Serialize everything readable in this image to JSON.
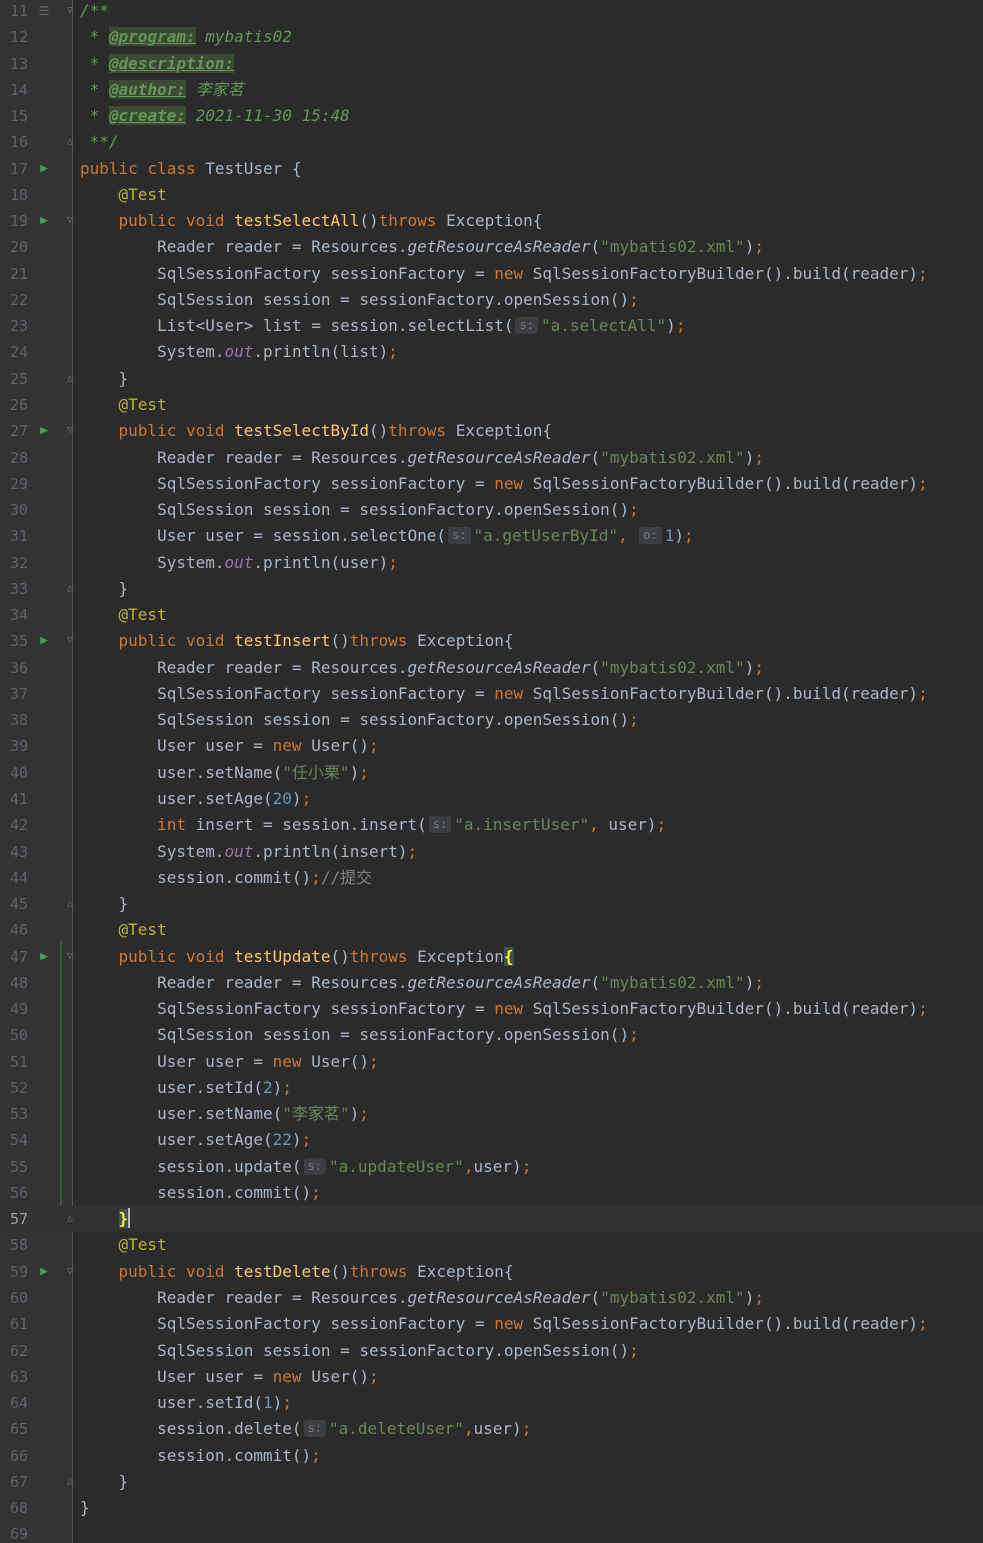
{
  "editor": {
    "current_line": "57",
    "lines": [
      {
        "n": "11",
        "icon": "structure",
        "fold": "open",
        "tokens": [
          {
            "t": "/**",
            "c": "dc"
          }
        ]
      },
      {
        "n": "12",
        "tokens": [
          {
            "t": " * ",
            "c": "dc"
          },
          {
            "t": "@program:",
            "c": "tg"
          },
          {
            "t": " mybatis02",
            "c": "dc"
          }
        ]
      },
      {
        "n": "13",
        "tokens": [
          {
            "t": " * ",
            "c": "dc"
          },
          {
            "t": "@description:",
            "c": "tg"
          }
        ]
      },
      {
        "n": "14",
        "tokens": [
          {
            "t": " * ",
            "c": "dc"
          },
          {
            "t": "@author:",
            "c": "tg"
          },
          {
            "t": " 李家茗",
            "c": "dc"
          }
        ]
      },
      {
        "n": "15",
        "tokens": [
          {
            "t": " * ",
            "c": "dc"
          },
          {
            "t": "@create:",
            "c": "tg"
          },
          {
            "t": " 2021-11-30 15:48",
            "c": "dc"
          }
        ]
      },
      {
        "n": "16",
        "fold": "close",
        "tokens": [
          {
            "t": " **/",
            "c": "dc"
          }
        ]
      },
      {
        "n": "17",
        "icon": "run",
        "tokens": [
          {
            "t": "public class ",
            "c": "kw"
          },
          {
            "t": "TestUser {"
          }
        ]
      },
      {
        "n": "18",
        "tokens": [
          {
            "t": "    "
          },
          {
            "t": "@Test",
            "c": "an"
          }
        ]
      },
      {
        "n": "19",
        "icon": "run",
        "fold": "open",
        "tokens": [
          {
            "t": "    "
          },
          {
            "t": "public void ",
            "c": "kw"
          },
          {
            "t": "testSelectAll",
            "c": "fn"
          },
          {
            "t": "()"
          },
          {
            "t": "throws ",
            "c": "kw"
          },
          {
            "t": "Exception{"
          }
        ]
      },
      {
        "n": "20",
        "tokens": [
          {
            "t": "        Reader reader = Resources."
          },
          {
            "t": "getResourceAsReader",
            "c": "si"
          },
          {
            "t": "("
          },
          {
            "t": "\"mybatis02.xml\"",
            "c": "st"
          },
          {
            "t": ")"
          },
          {
            "t": ";",
            "c": "kw"
          }
        ]
      },
      {
        "n": "21",
        "tokens": [
          {
            "t": "        SqlSessionFactory sessionFactory = "
          },
          {
            "t": "new ",
            "c": "kw"
          },
          {
            "t": "SqlSessionFactoryBuilder().build(reader)"
          },
          {
            "t": ";",
            "c": "kw"
          }
        ]
      },
      {
        "n": "22",
        "tokens": [
          {
            "t": "        SqlSession session = sessionFactory.openSession()"
          },
          {
            "t": ";",
            "c": "kw"
          }
        ]
      },
      {
        "n": "23",
        "tokens": [
          {
            "t": "        List<User> list = session.selectList("
          },
          {
            "hint": "s:"
          },
          {
            "t": "\"a.selectAll\"",
            "c": "st"
          },
          {
            "t": ")"
          },
          {
            "t": ";",
            "c": "kw"
          }
        ]
      },
      {
        "n": "24",
        "tokens": [
          {
            "t": "        System."
          },
          {
            "t": "out",
            "c": "it"
          },
          {
            "t": ".println(list)"
          },
          {
            "t": ";",
            "c": "kw"
          }
        ]
      },
      {
        "n": "25",
        "fold": "close",
        "tokens": [
          {
            "t": "    }"
          }
        ]
      },
      {
        "n": "26",
        "tokens": [
          {
            "t": "    "
          },
          {
            "t": "@Test",
            "c": "an"
          }
        ]
      },
      {
        "n": "27",
        "icon": "run",
        "fold": "open",
        "tokens": [
          {
            "t": "    "
          },
          {
            "t": "public void ",
            "c": "kw"
          },
          {
            "t": "testSelectById",
            "c": "fn"
          },
          {
            "t": "()"
          },
          {
            "t": "throws ",
            "c": "kw"
          },
          {
            "t": "Exception{"
          }
        ]
      },
      {
        "n": "28",
        "tokens": [
          {
            "t": "        Reader reader = Resources."
          },
          {
            "t": "getResourceAsReader",
            "c": "si"
          },
          {
            "t": "("
          },
          {
            "t": "\"mybatis02.xml\"",
            "c": "st"
          },
          {
            "t": ")"
          },
          {
            "t": ";",
            "c": "kw"
          }
        ]
      },
      {
        "n": "29",
        "tokens": [
          {
            "t": "        SqlSessionFactory sessionFactory = "
          },
          {
            "t": "new ",
            "c": "kw"
          },
          {
            "t": "SqlSessionFactoryBuilder().build(reader)"
          },
          {
            "t": ";",
            "c": "kw"
          }
        ]
      },
      {
        "n": "30",
        "tokens": [
          {
            "t": "        SqlSession session = sessionFactory.openSession()"
          },
          {
            "t": ";",
            "c": "kw"
          }
        ]
      },
      {
        "n": "31",
        "tokens": [
          {
            "t": "        User user = session.selectOne("
          },
          {
            "hint": "s:"
          },
          {
            "t": "\"a.getUserById\"",
            "c": "st"
          },
          {
            "t": ",",
            "c": "kw"
          },
          {
            "t": " "
          },
          {
            "hint": "o:"
          },
          {
            "t": "1",
            "c": "nu"
          },
          {
            "t": ")"
          },
          {
            "t": ";",
            "c": "kw"
          }
        ]
      },
      {
        "n": "32",
        "tokens": [
          {
            "t": "        System."
          },
          {
            "t": "out",
            "c": "it"
          },
          {
            "t": ".println(user)"
          },
          {
            "t": ";",
            "c": "kw"
          }
        ]
      },
      {
        "n": "33",
        "fold": "close",
        "tokens": [
          {
            "t": "    }"
          }
        ]
      },
      {
        "n": "34",
        "tokens": [
          {
            "t": "    "
          },
          {
            "t": "@Test",
            "c": "an"
          }
        ]
      },
      {
        "n": "35",
        "icon": "run",
        "fold": "open",
        "tokens": [
          {
            "t": "    "
          },
          {
            "t": "public void ",
            "c": "kw"
          },
          {
            "t": "testInsert",
            "c": "fn"
          },
          {
            "t": "()"
          },
          {
            "t": "throws ",
            "c": "kw"
          },
          {
            "t": "Exception{"
          }
        ]
      },
      {
        "n": "36",
        "tokens": [
          {
            "t": "        Reader reader = Resources."
          },
          {
            "t": "getResourceAsReader",
            "c": "si"
          },
          {
            "t": "("
          },
          {
            "t": "\"mybatis02.xml\"",
            "c": "st"
          },
          {
            "t": ")"
          },
          {
            "t": ";",
            "c": "kw"
          }
        ]
      },
      {
        "n": "37",
        "tokens": [
          {
            "t": "        SqlSessionFactory sessionFactory = "
          },
          {
            "t": "new ",
            "c": "kw"
          },
          {
            "t": "SqlSessionFactoryBuilder().build(reader)"
          },
          {
            "t": ";",
            "c": "kw"
          }
        ]
      },
      {
        "n": "38",
        "tokens": [
          {
            "t": "        SqlSession session = sessionFactory.openSession()"
          },
          {
            "t": ";",
            "c": "kw"
          }
        ]
      },
      {
        "n": "39",
        "tokens": [
          {
            "t": "        User user = "
          },
          {
            "t": "new ",
            "c": "kw"
          },
          {
            "t": "User()"
          },
          {
            "t": ";",
            "c": "kw"
          }
        ]
      },
      {
        "n": "40",
        "tokens": [
          {
            "t": "        user.setName("
          },
          {
            "t": "\"任小栗\"",
            "c": "st"
          },
          {
            "t": ")"
          },
          {
            "t": ";",
            "c": "kw"
          }
        ]
      },
      {
        "n": "41",
        "tokens": [
          {
            "t": "        user.setAge("
          },
          {
            "t": "20",
            "c": "nu"
          },
          {
            "t": ")"
          },
          {
            "t": ";",
            "c": "kw"
          }
        ]
      },
      {
        "n": "42",
        "tokens": [
          {
            "t": "        "
          },
          {
            "t": "int ",
            "c": "kw"
          },
          {
            "t": "insert = session.insert("
          },
          {
            "hint": "s:"
          },
          {
            "t": "\"a.insertUser\"",
            "c": "st"
          },
          {
            "t": ",",
            "c": "kw"
          },
          {
            "t": " user)"
          },
          {
            "t": ";",
            "c": "kw"
          }
        ]
      },
      {
        "n": "43",
        "tokens": [
          {
            "t": "        System."
          },
          {
            "t": "out",
            "c": "it"
          },
          {
            "t": ".println(insert)"
          },
          {
            "t": ";",
            "c": "kw"
          }
        ]
      },
      {
        "n": "44",
        "tokens": [
          {
            "t": "        session.commit()"
          },
          {
            "t": ";",
            "c": "kw"
          },
          {
            "t": "//提交",
            "c": "cm"
          }
        ]
      },
      {
        "n": "45",
        "fold": "close",
        "tokens": [
          {
            "t": "    }"
          }
        ]
      },
      {
        "n": "46",
        "tokens": [
          {
            "t": "    "
          },
          {
            "t": "@Test",
            "c": "an"
          }
        ]
      },
      {
        "n": "47",
        "icon": "run",
        "fold": "open",
        "tokens": [
          {
            "t": "    "
          },
          {
            "t": "public void ",
            "c": "kw"
          },
          {
            "t": "testUpdate",
            "c": "fn"
          },
          {
            "t": "()"
          },
          {
            "t": "throws ",
            "c": "kw"
          },
          {
            "t": "Exception"
          },
          {
            "t": "{",
            "c": "hl"
          }
        ]
      },
      {
        "n": "48",
        "tokens": [
          {
            "t": "        Reader reader = Resources."
          },
          {
            "t": "getResourceAsReader",
            "c": "si"
          },
          {
            "t": "("
          },
          {
            "t": "\"mybatis02.xml\"",
            "c": "st"
          },
          {
            "t": ")"
          },
          {
            "t": ";",
            "c": "kw"
          }
        ]
      },
      {
        "n": "49",
        "tokens": [
          {
            "t": "        SqlSessionFactory sessionFactory = "
          },
          {
            "t": "new ",
            "c": "kw"
          },
          {
            "t": "SqlSessionFactoryBuilder().build(reader)"
          },
          {
            "t": ";",
            "c": "kw"
          }
        ]
      },
      {
        "n": "50",
        "tokens": [
          {
            "t": "        SqlSession session = sessionFactory.openSession()"
          },
          {
            "t": ";",
            "c": "kw"
          }
        ]
      },
      {
        "n": "51",
        "tokens": [
          {
            "t": "        User user = "
          },
          {
            "t": "new ",
            "c": "kw"
          },
          {
            "t": "User()"
          },
          {
            "t": ";",
            "c": "kw"
          }
        ]
      },
      {
        "n": "52",
        "tokens": [
          {
            "t": "        user.setId("
          },
          {
            "t": "2",
            "c": "nu"
          },
          {
            "t": ")"
          },
          {
            "t": ";",
            "c": "kw"
          }
        ]
      },
      {
        "n": "53",
        "tokens": [
          {
            "t": "        user.setName("
          },
          {
            "t": "\"李家茗\"",
            "c": "st"
          },
          {
            "t": ")"
          },
          {
            "t": ";",
            "c": "kw"
          }
        ]
      },
      {
        "n": "54",
        "tokens": [
          {
            "t": "        user.setAge("
          },
          {
            "t": "22",
            "c": "nu"
          },
          {
            "t": ")"
          },
          {
            "t": ";",
            "c": "kw"
          }
        ]
      },
      {
        "n": "55",
        "tokens": [
          {
            "t": "        session.update("
          },
          {
            "hint": "s:"
          },
          {
            "t": "\"a.updateUser\"",
            "c": "st"
          },
          {
            "t": ",",
            "c": "kw"
          },
          {
            "t": "user)"
          },
          {
            "t": ";",
            "c": "kw"
          }
        ]
      },
      {
        "n": "56",
        "tokens": [
          {
            "t": "        session.commit()"
          },
          {
            "t": ";",
            "c": "kw"
          }
        ]
      },
      {
        "n": "57",
        "fold": "close",
        "tokens": [
          {
            "t": "    "
          },
          {
            "t": "}",
            "c": "hl"
          },
          {
            "caret": true
          }
        ]
      },
      {
        "n": "58",
        "tokens": [
          {
            "t": "    "
          },
          {
            "t": "@Test",
            "c": "an"
          }
        ]
      },
      {
        "n": "59",
        "icon": "run",
        "fold": "open",
        "tokens": [
          {
            "t": "    "
          },
          {
            "t": "public void ",
            "c": "kw"
          },
          {
            "t": "testDelete",
            "c": "fn"
          },
          {
            "t": "()"
          },
          {
            "t": "throws ",
            "c": "kw"
          },
          {
            "t": "Exception{"
          }
        ]
      },
      {
        "n": "60",
        "tokens": [
          {
            "t": "        Reader reader = Resources."
          },
          {
            "t": "getResourceAsReader",
            "c": "si"
          },
          {
            "t": "("
          },
          {
            "t": "\"mybatis02.xml\"",
            "c": "st"
          },
          {
            "t": ")"
          },
          {
            "t": ";",
            "c": "kw"
          }
        ]
      },
      {
        "n": "61",
        "tokens": [
          {
            "t": "        SqlSessionFactory sessionFactory = "
          },
          {
            "t": "new ",
            "c": "kw"
          },
          {
            "t": "SqlSessionFactoryBuilder().build(reader)"
          },
          {
            "t": ";",
            "c": "kw"
          }
        ]
      },
      {
        "n": "62",
        "tokens": [
          {
            "t": "        SqlSession session = sessionFactory.openSession()"
          },
          {
            "t": ";",
            "c": "kw"
          }
        ]
      },
      {
        "n": "63",
        "tokens": [
          {
            "t": "        User user = "
          },
          {
            "t": "new ",
            "c": "kw"
          },
          {
            "t": "User()"
          },
          {
            "t": ";",
            "c": "kw"
          }
        ]
      },
      {
        "n": "64",
        "tokens": [
          {
            "t": "        user.setId("
          },
          {
            "t": "1",
            "c": "nu"
          },
          {
            "t": ")"
          },
          {
            "t": ";",
            "c": "kw"
          }
        ]
      },
      {
        "n": "65",
        "tokens": [
          {
            "t": "        session.delete("
          },
          {
            "hint": "s:"
          },
          {
            "t": "\"a.deleteUser\"",
            "c": "st"
          },
          {
            "t": ",",
            "c": "kw"
          },
          {
            "t": "user)"
          },
          {
            "t": ";",
            "c": "kw"
          }
        ]
      },
      {
        "n": "66",
        "tokens": [
          {
            "t": "        session.commit()"
          },
          {
            "t": ";",
            "c": "kw"
          }
        ]
      },
      {
        "n": "67",
        "fold": "close",
        "tokens": [
          {
            "t": "    }"
          }
        ]
      },
      {
        "n": "68",
        "tokens": [
          {
            "t": "}"
          }
        ]
      },
      {
        "n": "69",
        "tokens": []
      }
    ]
  }
}
